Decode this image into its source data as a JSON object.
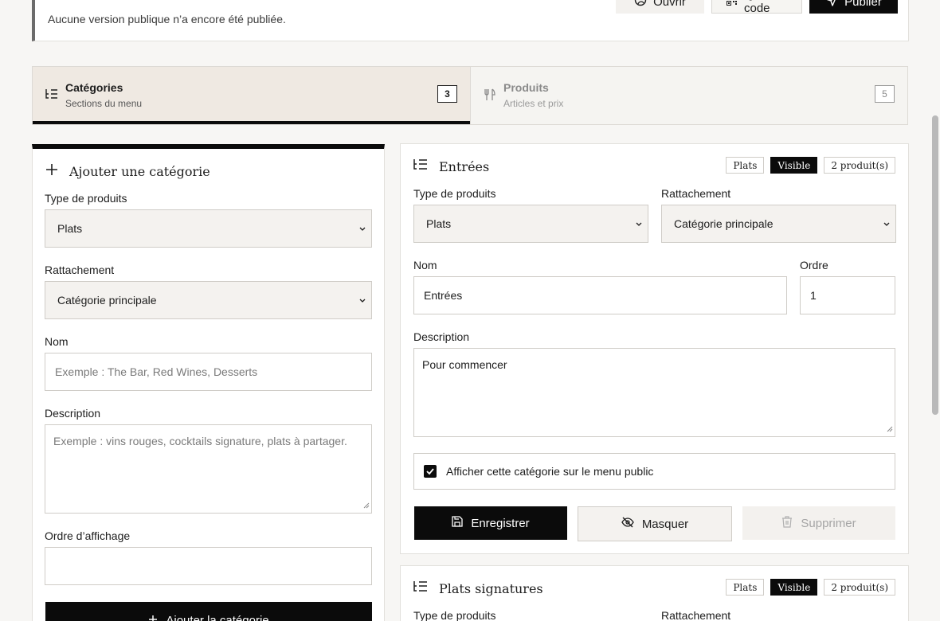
{
  "banner": {
    "text": "Aucune version publique n’a encore été publiée.",
    "open_label": "Ouvrir",
    "qr_label": "QR code",
    "publish_label": "Publier"
  },
  "tabs": [
    {
      "title": "Catégories",
      "subtitle": "Sections du menu",
      "count": "3",
      "active": true,
      "icon": "list-tree-icon"
    },
    {
      "title": "Produits",
      "subtitle": "Articles et prix",
      "count": "5",
      "active": false,
      "icon": "cutlery-icon"
    }
  ],
  "add_form": {
    "heading": "Ajouter une catégorie",
    "type_label": "Type de produits",
    "type_value": "Plats",
    "attach_label": "Rattachement",
    "attach_value": "Catégorie principale",
    "name_label": "Nom",
    "name_placeholder": "Exemple : The Bar, Red Wines, Desserts",
    "desc_label": "Description",
    "desc_placeholder": "Exemple : vins rouges, cocktails signature, plats à partager.",
    "order_label": "Ordre d’affichage",
    "order_value": "",
    "submit_label": "Ajouter la catégorie"
  },
  "categories": [
    {
      "title": "Entrées",
      "badge_type": "Plats",
      "badge_visibility": "Visible",
      "badge_count": "2 produit(s)",
      "type_label": "Type de produits",
      "type_value": "Plats",
      "attach_label": "Rattachement",
      "attach_value": "Catégorie principale",
      "name_label": "Nom",
      "name_value": "Entrées",
      "order_label": "Ordre",
      "order_value": "1",
      "desc_label": "Description",
      "desc_value": "Pour commencer",
      "show_label": "Afficher cette catégorie sur le menu public",
      "show_checked": true,
      "save_label": "Enregistrer",
      "hide_label": "Masquer",
      "delete_label": "Supprimer"
    },
    {
      "title": "Plats signatures",
      "badge_type": "Plats",
      "badge_visibility": "Visible",
      "badge_count": "2 produit(s)",
      "type_label": "Type de produits",
      "attach_label": "Rattachement"
    }
  ]
}
